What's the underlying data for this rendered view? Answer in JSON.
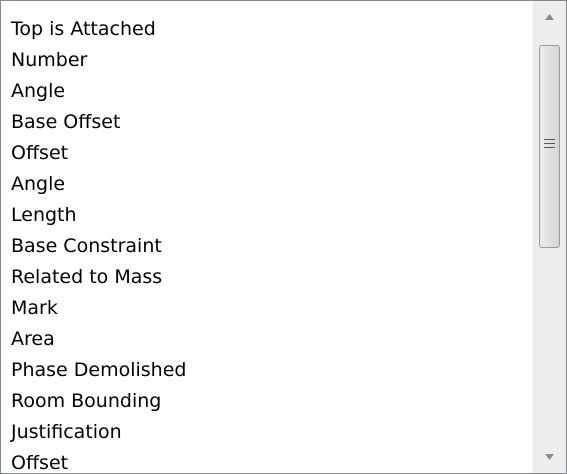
{
  "listbox": {
    "items": [
      {
        "label": "Top is Attached"
      },
      {
        "label": "Number"
      },
      {
        "label": "Angle"
      },
      {
        "label": "Base Offset"
      },
      {
        "label": "Offset"
      },
      {
        "label": "Angle"
      },
      {
        "label": "Length"
      },
      {
        "label": "Base Constraint"
      },
      {
        "label": "Related to Mass"
      },
      {
        "label": "Mark"
      },
      {
        "label": "Area"
      },
      {
        "label": "Phase Demolished"
      },
      {
        "label": "Room Bounding"
      },
      {
        "label": "Justification"
      },
      {
        "label": "Offset"
      }
    ]
  },
  "scrollbar": {
    "up_icon": "chevron-up-icon",
    "down_icon": "chevron-down-icon",
    "grip_icon": "grip-lines-icon"
  }
}
